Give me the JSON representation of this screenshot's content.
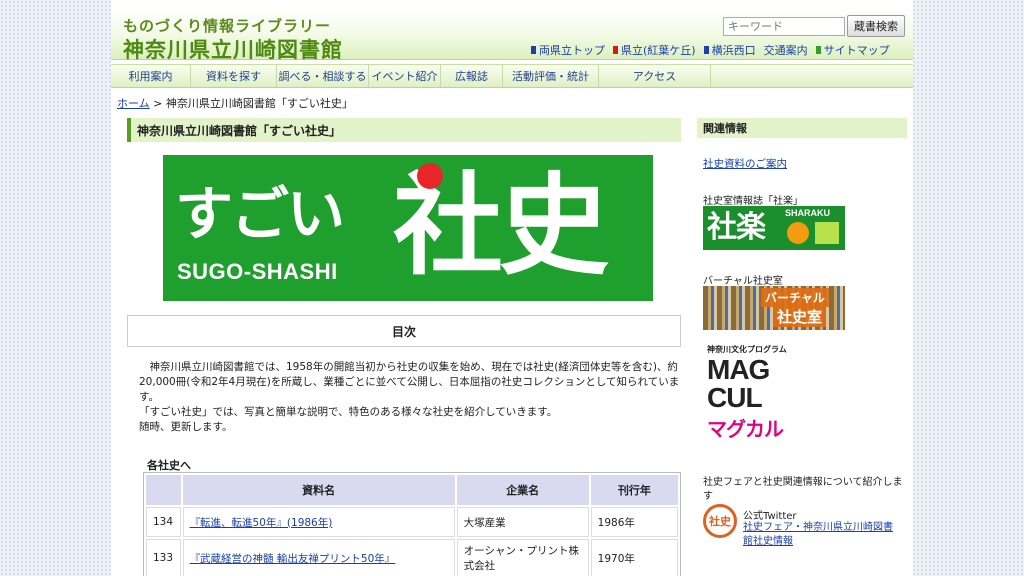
{
  "header": {
    "subtitle": "ものづくり情報ライブラリー",
    "title": "神奈川県立川崎図書館",
    "search_placeholder": "キーワード",
    "search_button": "蔵書検索",
    "links": [
      {
        "label": "両県立トップ",
        "color": "#1a3fb0"
      },
      {
        "label": "県立(紅葉ケ丘)",
        "color": "#d11a1a"
      },
      {
        "label": "横浜西口",
        "color": "#1a3fb0"
      },
      {
        "label": "交通案内",
        "color": ""
      },
      {
        "label": "サイトマップ",
        "color": "#33a02c"
      }
    ]
  },
  "nav": [
    "利用案内",
    "資料を探す",
    "調べる・相談する",
    "イベント紹介",
    "広報誌",
    "活動評価・統計",
    "アクセス"
  ],
  "breadcrumb": {
    "home": "ホーム",
    "sep": ">",
    "current": "神奈川県立川崎図書館「すごい社史」"
  },
  "main": {
    "title": "神奈川県立川崎図書館「すごい社史」",
    "banner": {
      "sugoi": "すごい",
      "shashi": "社史",
      "roman": "SUGO-SHASHI"
    },
    "toc": "目次",
    "intro": [
      "神奈川県立川崎図書館では、1958年の開館当初から社史の収集を始め、現在では社史(経済団体史等を含む)、約20,000冊(令和2年4月現在)を所蔵し、業種ごとに並べて公開し、日本屈指の社史コレクションとして知られています。",
      "「すごい社史」では、写真と簡単な説明で、特色のある様々な社史を紹介していきます。",
      "随時、更新します。"
    ],
    "list_heading": "各社史へ",
    "table": {
      "headers": [
        "",
        "資料名",
        "企業名",
        "刊行年"
      ],
      "rows": [
        {
          "no": "134",
          "title": "『転進、転進50年』(1986年)",
          "company": "大塚産業",
          "year": "1986年"
        },
        {
          "no": "133",
          "title": "『武蔵経営の神髄 輸出友禅プリント50年』",
          "company": "オーシャン・プリント株式会社",
          "year": "1970年"
        }
      ]
    }
  },
  "side": {
    "title": "関連情報",
    "link1": "社史資料のご案内",
    "sharaku_caption": "社史室情報誌「社楽」",
    "sharaku_logo": "社楽",
    "sharaku_roman": "SHARAKU",
    "virtual_caption": "バーチャル社史室",
    "virtual_line1": "バーチャル",
    "virtual_line2": "社史室",
    "magcul_caption": "神奈川文化プログラム",
    "magcul_rows": [
      "MAG",
      "CUL",
      "マグカル"
    ],
    "fair_text": "社史フェアと社史関連情報について紹介します",
    "twitter_label": "公式Twitter",
    "twitter_link": "社史フェア・神奈川県立川崎図書館社史情報",
    "twitter_stamp": "社史"
  },
  "colors": {
    "accent_green": "#4e8a12",
    "banner_green": "#1f9f2e",
    "red_dot": "#e8262a"
  }
}
